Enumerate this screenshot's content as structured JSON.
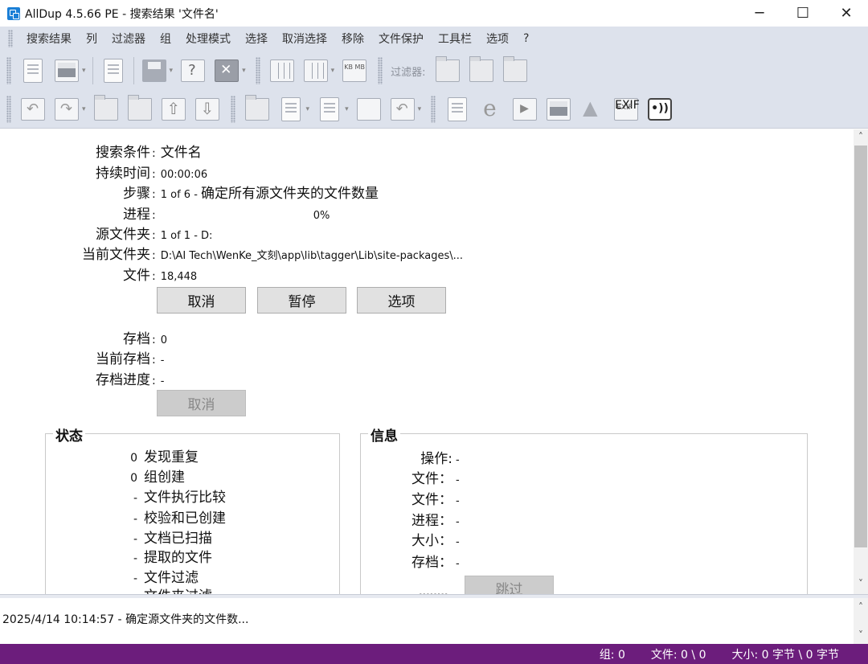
{
  "window": {
    "title": "AllDup 4.5.66 PE - 搜索结果 '文件名'",
    "controls": {
      "minimize": "─",
      "maximize": "☐",
      "close": "✕"
    }
  },
  "menu": [
    "搜索结果",
    "列",
    "过滤器",
    "组",
    "处理模式",
    "选择",
    "取消选择",
    "移除",
    "文件保护",
    "工具栏",
    "选项",
    "?"
  ],
  "toolbar": {
    "filter_label": "过滤器:",
    "kb_label": "KB\nMB",
    "log_label": "LOG",
    "exif_label": "EXIF"
  },
  "progress": {
    "search_criteria_label": "搜索条件",
    "search_criteria_value": "文件名",
    "duration_label": "持续时间",
    "duration_value": "00:00:06",
    "step_label": "步骤",
    "step_value": "1 of 6 - ",
    "step_desc": "确定所有源文件夹的文件数量",
    "progress_label": "进程",
    "progress_value": "0%",
    "source_folder_label": "源文件夹",
    "source_folder_value": "1 of 1 - D:",
    "current_folder_label": "当前文件夹",
    "current_folder_value": "D:\\AI Tech\\WenKe_文刻\\app\\lib\\tagger\\Lib\\site-packages\\...",
    "files_label": "文件",
    "files_value": "18,448",
    "buttons": {
      "cancel": "取消",
      "pause": "暂停",
      "options": "选项"
    }
  },
  "archive": {
    "archive_label": "存档",
    "archive_value": "0",
    "current_archive_label": "当前存档",
    "current_archive_value": "-",
    "archive_progress_label": "存档进度",
    "archive_progress_value": "-",
    "cancel_button": "取消"
  },
  "status_panel": {
    "title": "状态",
    "rows": [
      {
        "num": "0",
        "label": "发现重复"
      },
      {
        "num": "0",
        "label": "组创建"
      },
      {
        "num": "-",
        "label": "文件执行比较"
      },
      {
        "num": "-",
        "label": "校验和已创建"
      },
      {
        "num": "-",
        "label": "文档已扫描"
      },
      {
        "num": "-",
        "label": "提取的文件"
      },
      {
        "num": "-",
        "label": "文件过滤"
      },
      {
        "num": "",
        "label": "文件夹过滤"
      }
    ]
  },
  "info_panel": {
    "title": "信息",
    "rows": [
      {
        "label": "操作:",
        "value": "-"
      },
      {
        "label": "文件：",
        "value": "-"
      },
      {
        "label": "文件：",
        "value": "-"
      },
      {
        "label": "进程：",
        "value": "-"
      },
      {
        "label": "大小：",
        "value": "-"
      },
      {
        "label": "存档：",
        "value": "-"
      }
    ],
    "skip_button": "跳过",
    "dots": "........"
  },
  "log": {
    "entry": "2025/4/14 10:14:57 - 确定源文件夹的文件数..."
  },
  "statusbar": {
    "groups": "组: 0",
    "files": "文件: 0 \\ 0",
    "size": "大小: 0 字节 \\ 0 字节"
  },
  "colors": {
    "statusbar_bg": "#6c1d7c",
    "toolbar_bg": "#dde2ec",
    "app_icon": "#1b7fd6"
  }
}
